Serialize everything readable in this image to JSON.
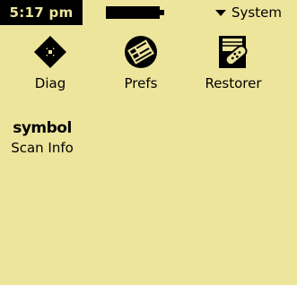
{
  "status_bar": {
    "time": "5:17 pm",
    "category": "System"
  },
  "apps": [
    {
      "label": "Diag",
      "icon": "diamond-icon"
    },
    {
      "label": "Prefs",
      "icon": "prefs-icon"
    },
    {
      "label": "Restorer",
      "icon": "restorer-icon"
    },
    {
      "label": "Scan Info",
      "icon": "symbol-logo",
      "logo_text": "symbol"
    }
  ],
  "colors": {
    "background": "#eee59c",
    "foreground": "#000000"
  }
}
